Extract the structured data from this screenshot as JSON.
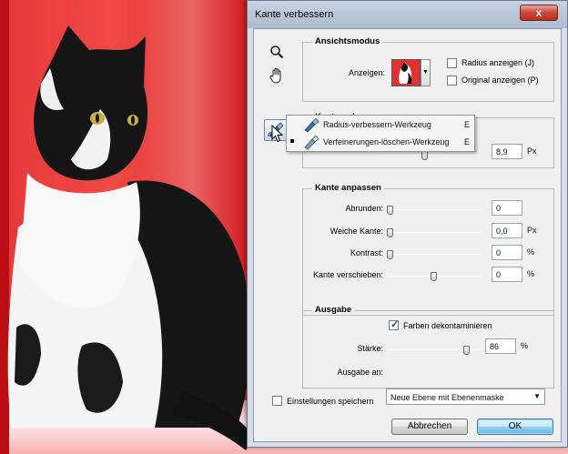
{
  "window": {
    "title": "Kante verbessern",
    "close_glyph": "x"
  },
  "tools": {
    "zoom": {
      "icon": "zoom-icon"
    },
    "hand": {
      "icon": "hand-icon"
    },
    "brush": {
      "icon": "refine-radius-brush-icon"
    }
  },
  "view_mode": {
    "title": "Ansichtsmodus",
    "show_label": "Anzeigen:",
    "show_radius": {
      "label": "Radius anzeigen (J)",
      "checked": false
    },
    "show_original": {
      "label": "Original anzeigen (P)",
      "checked": false
    }
  },
  "edge_detection": {
    "title": "Kantenerkennung",
    "radius_value": "8,9",
    "radius_unit": "Px"
  },
  "tool_menu": {
    "items": [
      {
        "label": "Radius-verbessern-Werkzeug",
        "shortcut": "E",
        "active": false
      },
      {
        "label": "Verfeinerungen-löschen-Werkzeug",
        "shortcut": "E",
        "active": true
      }
    ]
  },
  "adjust_edge": {
    "title": "Kante anpassen",
    "rows": [
      {
        "label": "Abrunden:",
        "value": "0",
        "unit": "",
        "level": 0
      },
      {
        "label": "Weiche Kante:",
        "value": "0,0",
        "unit": "Px",
        "level": 0
      },
      {
        "label": "Kontrast:",
        "value": "0",
        "unit": "%",
        "level": 0
      },
      {
        "label": "Kante verschieben:",
        "value": "0",
        "unit": "%",
        "level": 0.5
      }
    ]
  },
  "output": {
    "title": "Ausgabe",
    "decontaminate": {
      "label": "Farben dekontaminieren",
      "checked": true
    },
    "strength_label": "Stärke:",
    "strength_value": "86",
    "strength_unit": "%",
    "strength_level": 0.86,
    "output_to_label": "Ausgabe an:",
    "output_to_value": "Neue Ebene mit Ebenenmaske"
  },
  "remember": {
    "label": "Einstellungen speichern",
    "checked": false
  },
  "buttons": {
    "cancel": "Abbrechen",
    "ok": "OK"
  }
}
